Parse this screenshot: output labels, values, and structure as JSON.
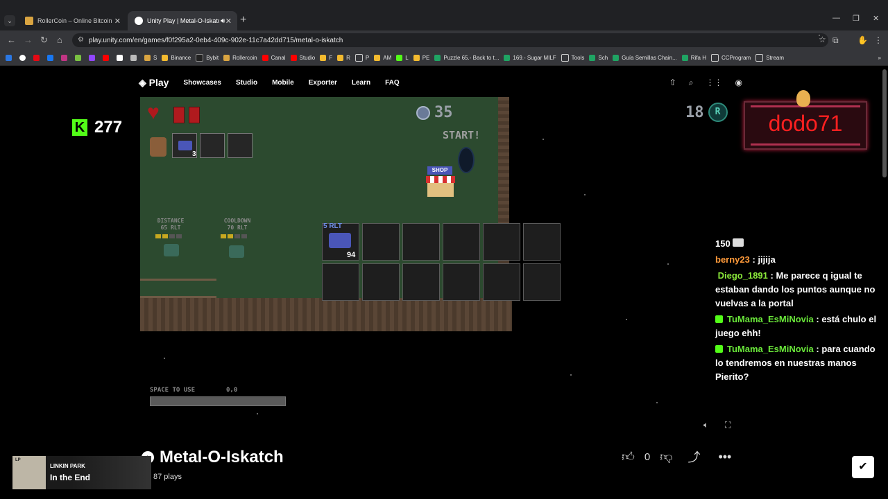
{
  "browser": {
    "tabs": [
      {
        "title": "RollerCoin – Online Bitcoin Min",
        "active": false
      },
      {
        "title": "Unity Play | Metal-O-Iskatch",
        "active": true
      }
    ],
    "url": "play.unity.com/en/games/f0f295a2-0eb4-409c-902e-11c7a42dd715/metal-o-iskatch",
    "bookmarks": [
      "S",
      "Binance",
      "Bybit",
      "Rollercoin",
      "Canal",
      "Studio",
      "F",
      "R",
      "P",
      "AM",
      "L",
      "PE",
      "Puzzle 65.- Back to t...",
      "169.- Sugar MILF",
      "Tools",
      "Sch",
      "Guía Semillas Chain...",
      "Rifa H",
      "CCProgram",
      "Stream"
    ]
  },
  "unity": {
    "logo": "Play",
    "nav": [
      "Showcases",
      "Studio",
      "Mobile",
      "Exporter",
      "Learn",
      "FAQ"
    ]
  },
  "game": {
    "timer": "35",
    "start_label": "START!",
    "shop_label": "SHOP",
    "inventory_count": "3",
    "distance_label": "DISTANCE",
    "distance_value": "65 RLT",
    "cooldown_label": "COOLDOWN",
    "cooldown_value": "70 RLT",
    "slot_price": "5 RLT",
    "slot_qty": "94",
    "space_label": "SPACE TO USE",
    "space_value": "0,0",
    "score": "18",
    "coin_symbol": "R"
  },
  "overlay": {
    "kick_count": "277",
    "streamer_name": "dodo71",
    "chat": [
      {
        "user": "",
        "text": "150 ",
        "badge": false
      },
      {
        "user": "berny23",
        "text": "jijija",
        "badge": false
      },
      {
        "user": "Diego_1891",
        "text": "Me parece q igual te estaban dando los puntos aunque no vuelvas a la portal",
        "badge": false
      },
      {
        "user": "TuMama_EsMiNovia",
        "text": "está chulo el juego ehh!",
        "badge": true
      },
      {
        "user": "TuMama_EsMiNovia",
        "text": "para cuando lo tendremos en nuestras manos Pierito?",
        "badge": true
      }
    ],
    "music_artist": "LINKIN PARK",
    "music_title": "In the End"
  },
  "page": {
    "game_title": "Metal-O-Iskatch",
    "plays": "87 plays",
    "likes": "0"
  }
}
